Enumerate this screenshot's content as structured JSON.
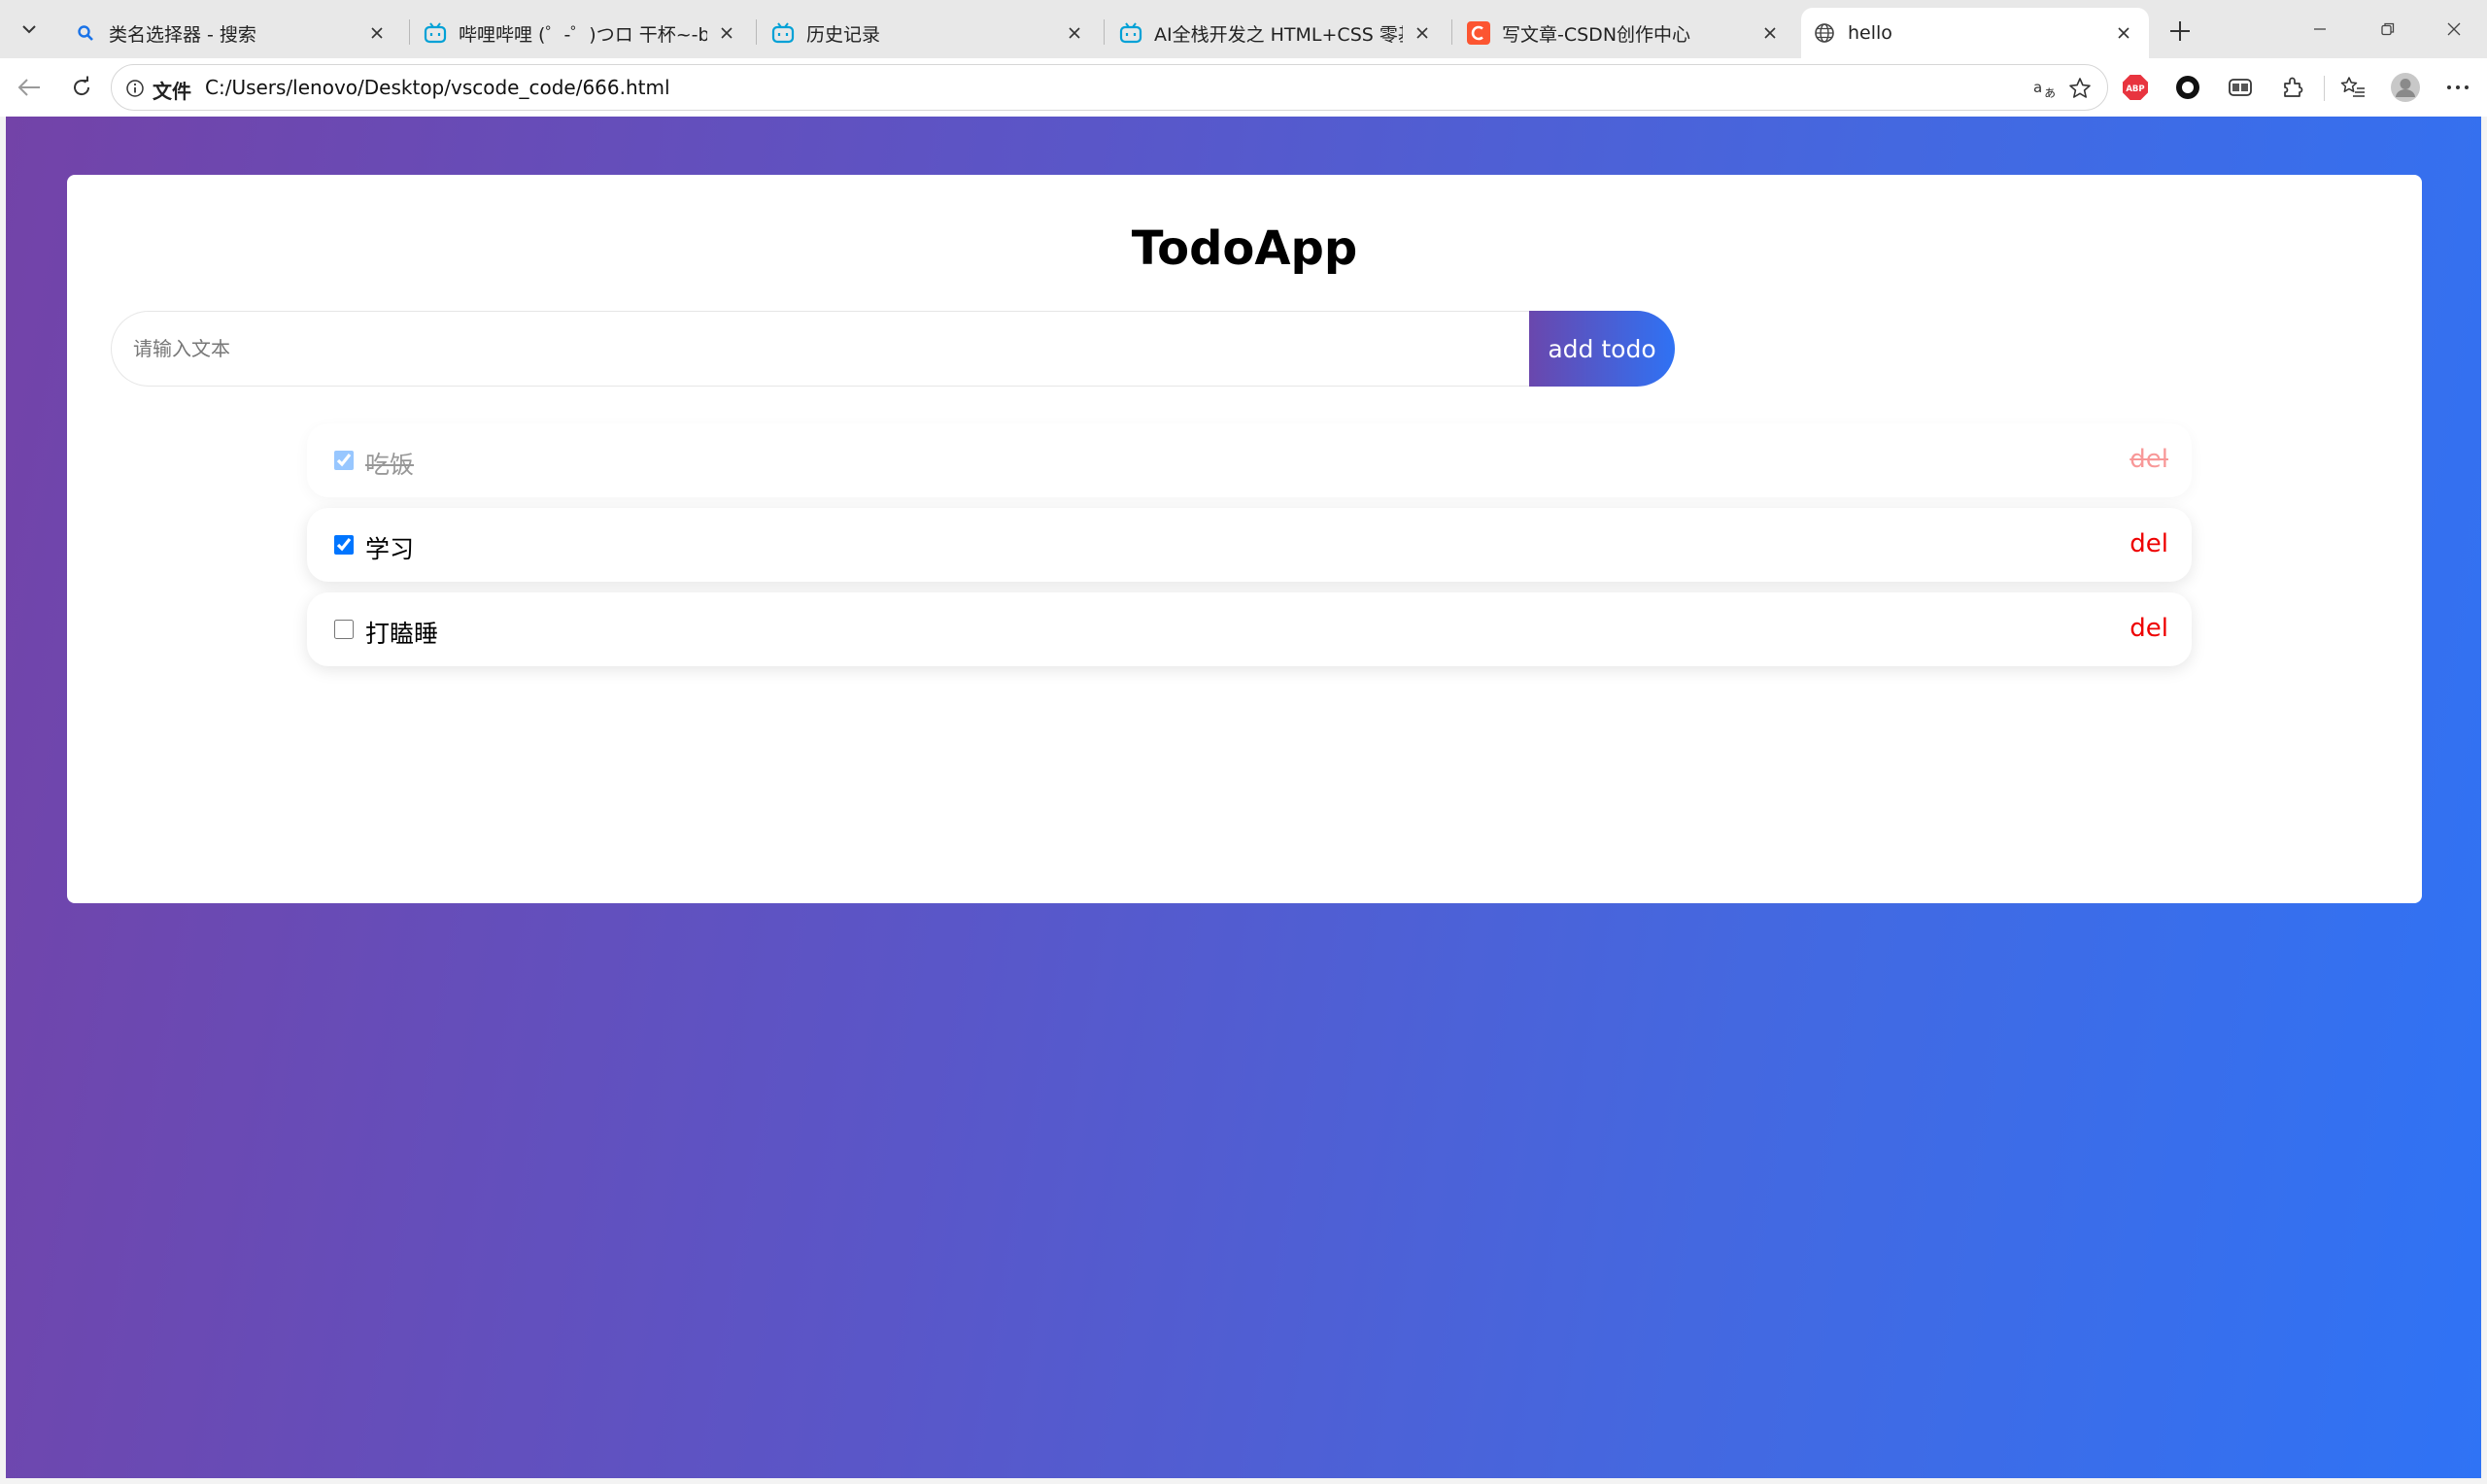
{
  "browser": {
    "tabs": [
      {
        "label": "类名选择器 - 搜索",
        "icon": "search-icon"
      },
      {
        "label": "哔哩哔哩 (゜-゜)つロ 干杯~-bilibili",
        "icon": "bilibili-icon"
      },
      {
        "label": "历史记录",
        "icon": "bilibili-icon"
      },
      {
        "label": "AI全栈开发之 HTML+CSS 零基础入门",
        "icon": "bilibili-icon"
      },
      {
        "label": "写文章-CSDN创作中心",
        "icon": "csdn-icon"
      },
      {
        "label": "hello",
        "icon": "globe-icon"
      }
    ],
    "address": {
      "scheme_label": "文件",
      "url": "C:/Users/lenovo/Desktop/vscode_code/666.html"
    },
    "colors": {
      "tab_strip": "#e8e8e8",
      "csdn_brand": "#fc5531",
      "bilibili_brand": "#00a1d6",
      "abp_brand": "#e8343f"
    }
  },
  "app": {
    "title": "TodoApp",
    "input_placeholder": "请输入文本",
    "input_value": "",
    "add_label": "add todo",
    "todos": [
      {
        "text": "吃饭",
        "done": true,
        "del_label": "del"
      },
      {
        "text": "学习",
        "done": true,
        "del_label": "del"
      },
      {
        "text": "打瞌睡",
        "done": false,
        "del_label": "del"
      }
    ],
    "colors": {
      "gradient_start": "#7343a8",
      "gradient_end": "#2f73f5",
      "delete_red": "#ee0000"
    }
  }
}
